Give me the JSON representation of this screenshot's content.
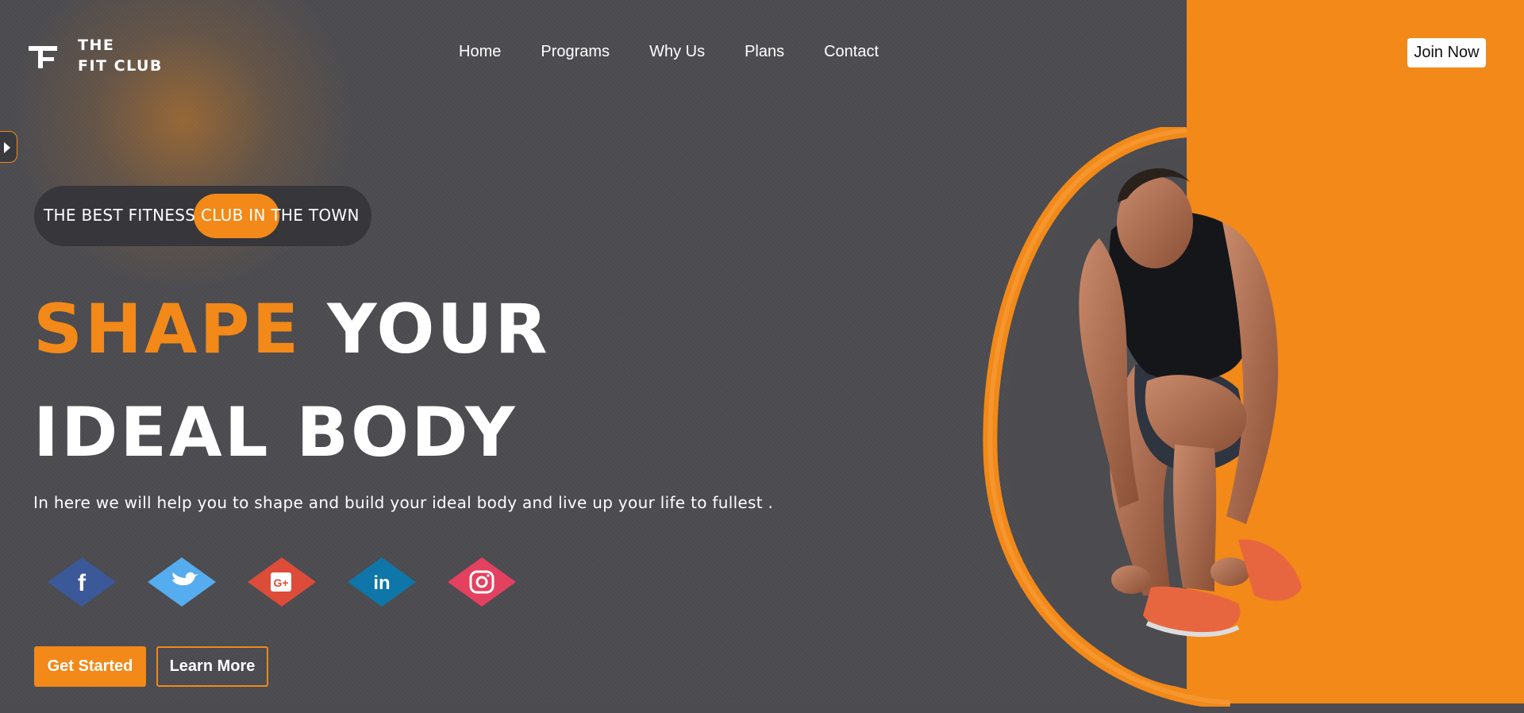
{
  "brand": {
    "line1": "THE",
    "line2": "FIT CLUB"
  },
  "nav": {
    "items": [
      "Home",
      "Programs",
      "Why Us",
      "Plans",
      "Contact"
    ]
  },
  "header": {
    "join_label": "Join Now"
  },
  "hero": {
    "tagline": "THE BEST FITNESS CLUB IN THE TOWN",
    "headline_orange": "SHAPE",
    "headline_rest_line1": "YOUR",
    "headline_line2": "IDEAL BODY",
    "description": "In here we will help you to shape and build your ideal body and live up your life to fullest .",
    "primary_button": "Get Started",
    "secondary_button": "Learn More"
  },
  "socials": [
    {
      "name": "facebook",
      "icon": "facebook-icon",
      "color": "#3b5998"
    },
    {
      "name": "twitter",
      "icon": "twitter-icon",
      "color": "#55acee"
    },
    {
      "name": "google-plus",
      "icon": "google-plus-icon",
      "color": "#dd4b39"
    },
    {
      "name": "linkedin",
      "icon": "linkedin-icon",
      "color": "#0e76a8"
    },
    {
      "name": "instagram",
      "icon": "instagram-icon",
      "color": "#e4405f"
    }
  ],
  "colors": {
    "accent": "#f28918",
    "background": "#4b4b50",
    "pill": "#36363b"
  }
}
